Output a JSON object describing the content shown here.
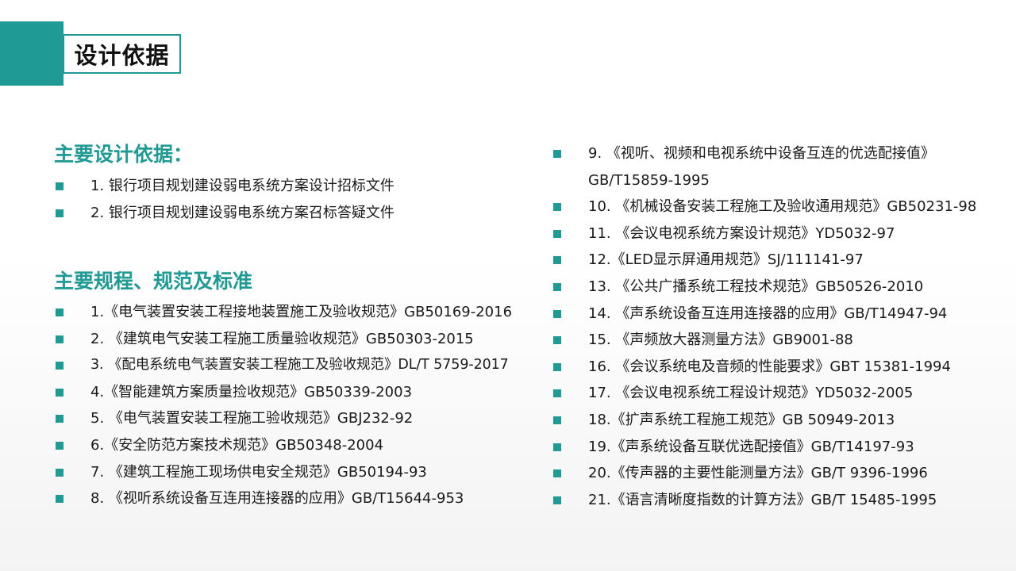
{
  "header": {
    "title": "设计依据"
  },
  "main_basis": {
    "heading": "主要设计依据：",
    "items": [
      "1.  银行项目规划建设弱电系统方案设计招标文件",
      "2.  银行项目规划建设弱电系统方案召标答疑文件"
    ]
  },
  "regulations": {
    "heading": "主要规程、规范及标准",
    "left_items": [
      "1.《电气装置安装工程接地装置施工及验收规范》GB50169-2016",
      "2. 《建筑电气安装工程施工质量验收规范》GB50303-2015",
      "3. 《配电系统电气装置安装工程施工及验收规范》DL/T 5759-2017",
      "4.《智能建筑方案质量捡收规范》GB50339-2003",
      "5. 《电气装置安装工程施工验收规范》GBJ232-92",
      "6.《安全防范方案技术规范》GB50348-2004",
      "7. 《建筑工程施工现场供电安全规范》GB50194-93",
      "8. 《视听系统设备互连用连接器的应用》GB/T15644-953"
    ],
    "right_first_line": "9. 《视听、视频和电视系统中设备互连的优选配接值》",
    "right_first_line2": "GB/T15859-1995",
    "right_items": [
      "10. 《机械设备安装工程施工及验收通用规范》GB50231-98",
      "11. 《会议电视系统方案设计规范》YD5032-97",
      "12.《LED显示屏通用规范》SJ/111141-97",
      "13. 《公共广播系统工程技术规范》GB50526-2010",
      "14. 《声系统设备互连用连接器的应用》GB/T14947-94",
      "15. 《声频放大器测量方法》GB9001-88",
      "16. 《会议系统电及音频的性能要求》GBT 15381-1994",
      "17. 《会议电视系统工程设计规范》YD5032-2005",
      "18.《扩声系统工程施工规范》GB 50949-2013",
      "19.《声系统设备互联优选配接值》GB/T14197-93",
      "20.《传声器的主要性能测量方法》GB/T 9396-1996",
      "21.《语言清晰度指数的计算方法》GB/T 15485-1995"
    ]
  },
  "colors": {
    "accent": "#1f9a94",
    "text": "#1a1a1a"
  }
}
